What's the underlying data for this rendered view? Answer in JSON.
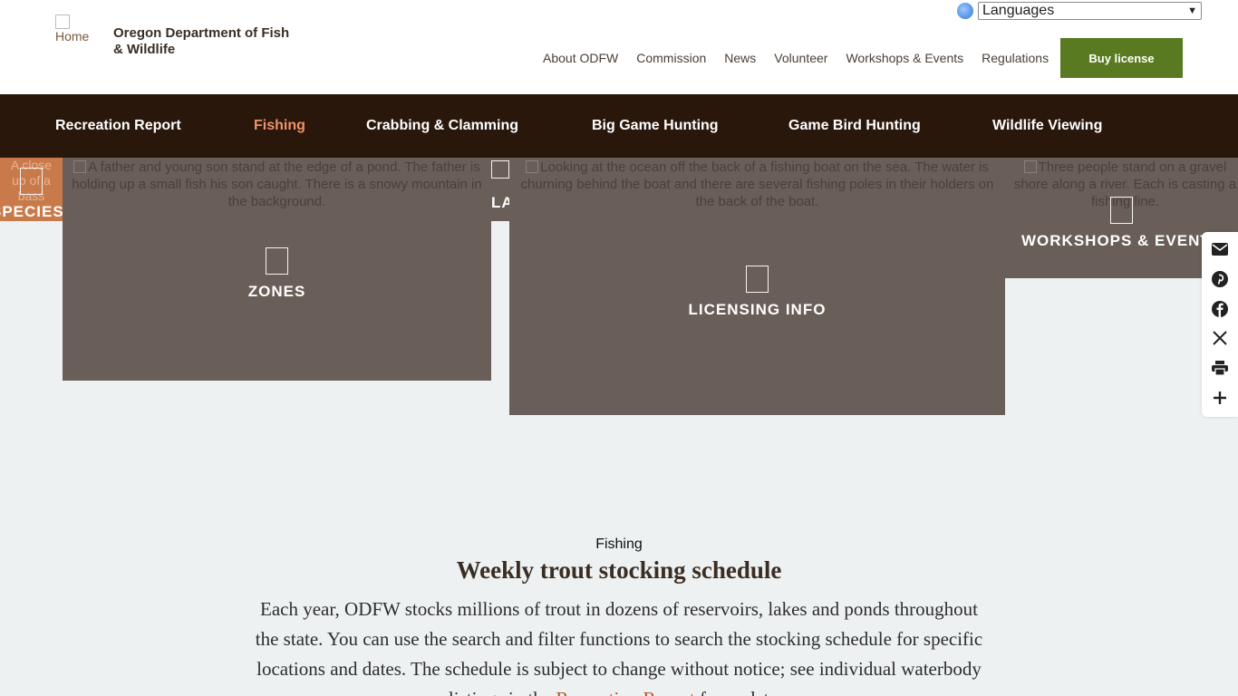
{
  "header": {
    "logo_alt": "Home",
    "org_name": "Oregon Department of Fish & Wildlife",
    "language_select": "Languages",
    "top_nav": [
      "About ODFW",
      "Commission",
      "News",
      "Volunteer",
      "Workshops & Events",
      "Regulations"
    ],
    "buy_license": "Buy license"
  },
  "main_nav": {
    "items": [
      "Recreation Report",
      "Fishing",
      "Crabbing & Clamming",
      "Big Game Hunting",
      "Game Bird Hunting",
      "Wildlife Viewing"
    ],
    "active": "Fishing"
  },
  "tiles": {
    "species": {
      "alt": "A close up of a bass",
      "label": "SPECIES"
    },
    "zones": {
      "alt": "A father and young son stand at the edge of a pond. The father is holding up a small fish his son caught. There is a snowy mountain in the background.",
      "label": "ZONES"
    },
    "lakes": {
      "label": "LAKES & DATA"
    },
    "licensing": {
      "alt": "Looking at the ocean off the back of a fishing boat on the sea. The water is churning behind the boat and there are several fishing poles in their holders on the back of the boat.",
      "label": "LICENSING INFO"
    },
    "workshops": {
      "alt": "Three people stand on a gravel shore along a river. Each is casting a fishing line.",
      "label": "WORKSHOPS & EVENTS"
    }
  },
  "share": {
    "icons": [
      "email-icon",
      "pinterest-icon",
      "facebook-icon",
      "x-icon",
      "print-icon",
      "plus-icon"
    ]
  },
  "content": {
    "section_label": "Fishing",
    "title": "Weekly trout stocking schedule",
    "intro": "Each year, ODFW stocks millions of trout in dozens of reservoirs, lakes and ponds throughout the state. You can use the search and filter functions to search the stocking schedule for specific locations and dates. The schedule is subject to change without notice; see individual waterbody listings in the",
    "intro_link": "Recreation Report",
    "intro_end": "for updates."
  },
  "colors": {
    "nav_bg": "#2a170c",
    "active_nav": "#f0936a",
    "buy_button": "#5a7a21",
    "tile_bg": "#6a5e58",
    "species_tile": "#c97a4a",
    "page_bg": "#eef1f1",
    "link": "#b3542a"
  }
}
